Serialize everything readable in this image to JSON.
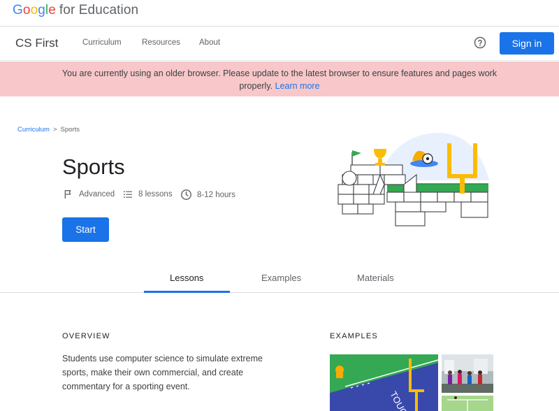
{
  "brand": {
    "google": "Google",
    "suffix": "for Education"
  },
  "nav": {
    "product": "CS First",
    "links": [
      "Curriculum",
      "Resources",
      "About"
    ],
    "sign_in": "Sign in"
  },
  "banner": {
    "message": "You are currently using an older browser. Please update to the latest browser to ensure features and pages work properly.",
    "link": "Learn more"
  },
  "breadcrumb": {
    "root": "Curriculum",
    "separator": ">",
    "current": "Sports"
  },
  "course": {
    "title": "Sports",
    "level": "Advanced",
    "lessons": "8 lessons",
    "ages": "8-12 hours",
    "start": "Start"
  },
  "tabs": [
    {
      "label": "Lessons",
      "active": true
    },
    {
      "label": "Examples",
      "active": false
    },
    {
      "label": "Materials",
      "active": false
    }
  ],
  "overview": {
    "heading": "OVERVIEW",
    "text": "Students use computer science to simulate extreme sports, make their own commercial, and create commentary for a sporting event."
  },
  "examples": {
    "heading": "EXAMPLES",
    "thumb_text": "TOUCHD"
  },
  "colors": {
    "accent": "#1a73e8",
    "banner_bg": "#f8c7c9",
    "field_green": "#34a853"
  }
}
